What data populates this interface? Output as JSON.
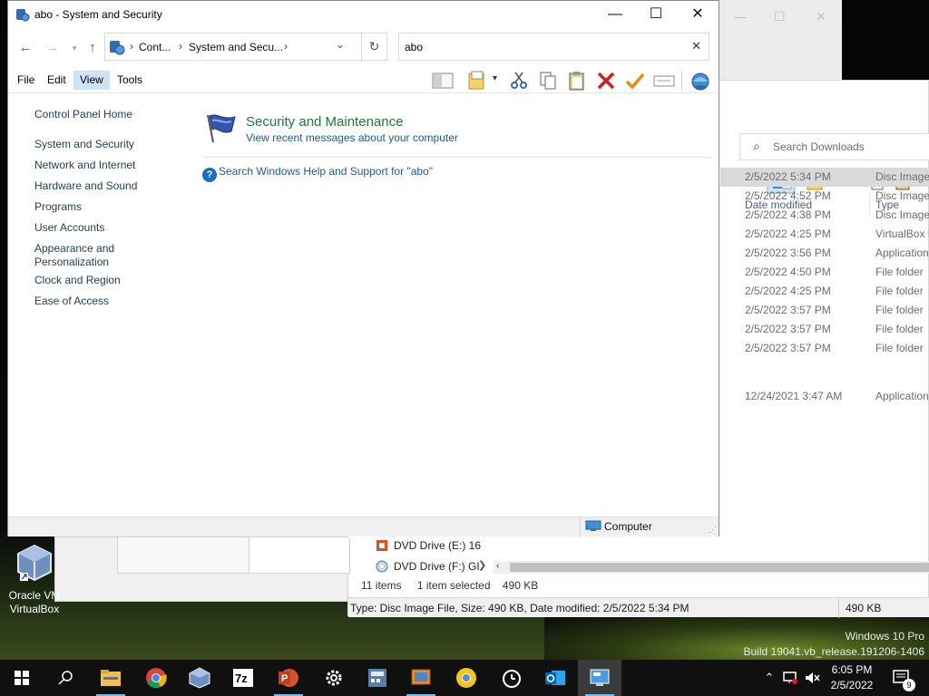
{
  "window": {
    "title": "abo - System and Security",
    "controls": {
      "minimize": "—",
      "maximize": "☐",
      "close": "✕"
    }
  },
  "address": {
    "crumbs": [
      "Cont...",
      "System and Secu..."
    ],
    "separator": "›"
  },
  "search": {
    "value": "abo"
  },
  "menu": {
    "file": "File",
    "edit": "Edit",
    "view": "View",
    "tools": "Tools"
  },
  "sidebar": {
    "items": [
      {
        "label": "Control Panel Home"
      },
      {
        "label": "System and Security"
      },
      {
        "label": "Network and Internet"
      },
      {
        "label": "Hardware and Sound"
      },
      {
        "label": "Programs"
      },
      {
        "label": "User Accounts"
      },
      {
        "label": "Appearance and"
      },
      {
        "label": "Personalization"
      },
      {
        "label": "Clock and Region"
      },
      {
        "label": "Ease of Access"
      }
    ]
  },
  "result": {
    "heading": "Security and Maintenance",
    "subtitle": "View recent messages about your computer",
    "help_link": "Search Windows Help and Support for \"abo\""
  },
  "status": {
    "location": "Computer"
  },
  "explorer": {
    "search_placeholder": "Search Downloads",
    "columns": {
      "date": "Date modified",
      "type": "Type"
    },
    "rows": [
      {
        "date": "2/5/2022 5:34 PM",
        "type": "Disc Image",
        "selected": true
      },
      {
        "date": "2/5/2022 4:52 PM",
        "type": "Disc Image"
      },
      {
        "date": "2/5/2022 4:38 PM",
        "type": "Disc Image"
      },
      {
        "date": "2/5/2022 4:25 PM",
        "type": "VirtualBox I"
      },
      {
        "date": "2/5/2022 3:56 PM",
        "type": "Application"
      },
      {
        "date": "2/5/2022 4:50 PM",
        "type": "File folder"
      },
      {
        "date": "2/5/2022 4:25 PM",
        "type": "File folder"
      },
      {
        "date": "2/5/2022 3:57 PM",
        "type": "File folder"
      },
      {
        "date": "2/5/2022 3:57 PM",
        "type": "File folder"
      },
      {
        "date": "2/5/2022 3:57 PM",
        "type": "File folder"
      },
      {
        "date": "12/24/2021 3:47 AM",
        "type": "Application"
      }
    ],
    "nav_items": [
      {
        "label": "DVD Drive (E:) 16"
      },
      {
        "label": "DVD Drive (F:) GI"
      }
    ],
    "status_items": "11 items",
    "status_selected": "1 item selected",
    "status_size": "490 KB",
    "details": "Type: Disc Image File, Size: 490 KB, Date modified: 2/5/2022 5:34 PM",
    "details_size": "490 KB"
  },
  "desktop": {
    "icon_line1": "Oracle VM",
    "icon_line2": "VirtualBox",
    "watermark_line1": "Windows 10 Pro",
    "watermark_line2": "Build 19041.vb_release.191206-1406"
  },
  "taskbar": {
    "time": "6:05 PM",
    "date": "2/5/2022",
    "notifications": "9",
    "apps": [
      "start-icon",
      "search-icon",
      "file-explorer-icon",
      "chrome-icon",
      "virtualbox-icon",
      "7zip-icon",
      "powerpoint-icon",
      "settings-icon",
      "calculator-icon",
      "virtualbox-manager-icon",
      "chrome-canary-icon",
      "alarm-clock-icon",
      "outlook-icon",
      "control-panel-icon"
    ]
  },
  "colors": {
    "accent": "#1e7a3a",
    "link": "#1c5a9c",
    "active_menu": "#cde3f7",
    "taskbar": "#101010"
  }
}
